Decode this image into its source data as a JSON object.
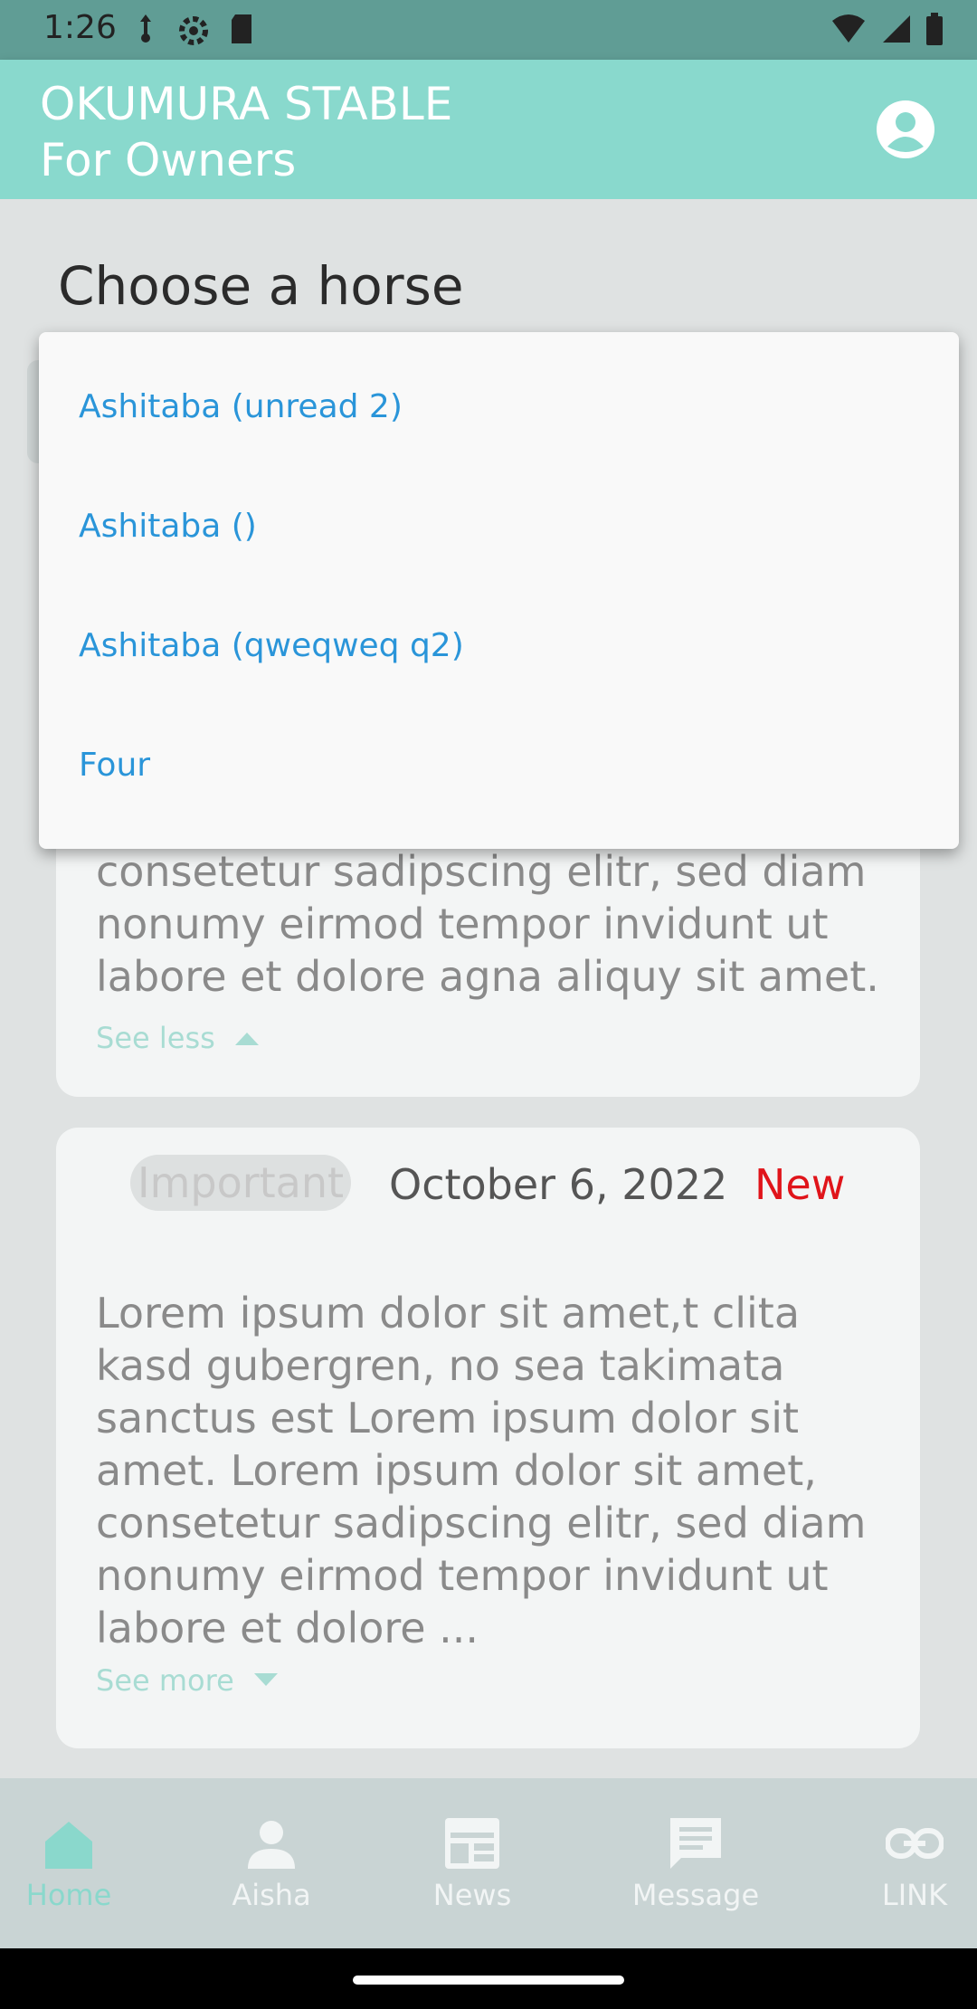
{
  "status_bar": {
    "time": "1:26",
    "icons_left": [
      "usb-debug-icon",
      "gear-icon",
      "sd-card-icon"
    ],
    "icons_right": [
      "wifi-icon",
      "signal-icon",
      "battery-icon"
    ]
  },
  "app_bar": {
    "title_line1": "OKUMURA STABLE",
    "title_line2": "For Owners",
    "account_icon": "account-circle-icon",
    "background": "#89d9cd"
  },
  "page": {
    "title": "Choose a horse"
  },
  "dropdown": {
    "items": [
      "Ashitaba (unread 2)",
      "Ashitaba ()",
      "Ashitaba (qweqweq q2)",
      "Four"
    ],
    "item_color": "#2a95d9"
  },
  "cards": [
    {
      "text": "consetetur sadipscing elitr, sed diam nonumy eirmod tempor invidunt ut labore et dolore agna aliquy sit amet.",
      "toggle": "See less"
    },
    {
      "badge": "Important",
      "date": "October 6, 2022",
      "new_label": "New",
      "text": "Lorem ipsum dolor sit amet,t clita kasd gubergren, no sea takimata sanctus est Lorem ipsum dolor sit amet. Lorem ipsum dolor sit amet, consetetur sadipscing elitr, sed diam nonumy eirmod tempor invidunt ut labore et dolore ...",
      "toggle": "See more"
    }
  ],
  "bottom_nav": {
    "items": [
      {
        "label": "Home",
        "icon": "home-icon",
        "active": true
      },
      {
        "label": "Aisha",
        "icon": "person-icon",
        "active": false
      },
      {
        "label": "News",
        "icon": "news-icon",
        "active": false
      },
      {
        "label": "Message",
        "icon": "message-icon",
        "active": false
      },
      {
        "label": "LINK",
        "icon": "link-icon",
        "active": false
      }
    ],
    "active_color": "#8ad8cc"
  }
}
